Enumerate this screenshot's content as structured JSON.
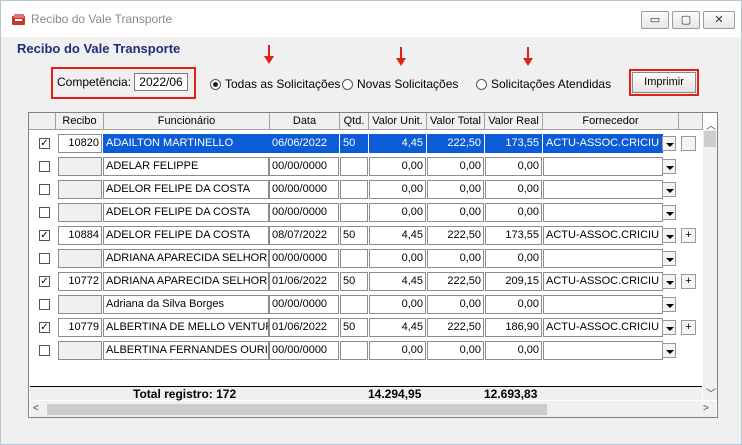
{
  "window": {
    "title": "Recibo do Vale Transporte",
    "buttons": {
      "min": "▭",
      "max": "▢",
      "close": "✕"
    }
  },
  "heading": "Recibo do Vale Transporte",
  "competencia": {
    "label": "Competência:",
    "value": "2022/06"
  },
  "filters": [
    {
      "label": "Todas as Solicitações",
      "selected": true
    },
    {
      "label": "Novas Solicitações",
      "selected": false
    },
    {
      "label": "Solicitações Atendidas",
      "selected": false
    }
  ],
  "print_label": "Imprimir",
  "columns": [
    "Recibo",
    "Funcionário",
    "Data",
    "Qtd.",
    "Valor Unit.",
    "Valor Total",
    "Valor Real",
    "Fornecedor"
  ],
  "rows": [
    {
      "checked": true,
      "recibo": "10820",
      "funcionario": "ADAILTON MARTINELLO",
      "data": "06/06/2022",
      "qtd": "50",
      "unit": "4,45",
      "total": "222,50",
      "real": "173,55",
      "fornecedor": "ACTU-ASSOC.CRICIU",
      "plus": ""
    },
    {
      "checked": false,
      "recibo": "",
      "funcionario": "ADELAR FELIPPE",
      "data": "00/00/0000",
      "qtd": "",
      "unit": "0,00",
      "total": "0,00",
      "real": "0,00",
      "fornecedor": "",
      "plus": ""
    },
    {
      "checked": false,
      "recibo": "",
      "funcionario": "ADELOR FELIPE DA COSTA",
      "data": "00/00/0000",
      "qtd": "",
      "unit": "0,00",
      "total": "0,00",
      "real": "0,00",
      "fornecedor": "",
      "plus": ""
    },
    {
      "checked": false,
      "recibo": "",
      "funcionario": "ADELOR FELIPE DA COSTA",
      "data": "00/00/0000",
      "qtd": "",
      "unit": "0,00",
      "total": "0,00",
      "real": "0,00",
      "fornecedor": "",
      "plus": ""
    },
    {
      "checked": true,
      "recibo": "10884",
      "funcionario": "ADELOR FELIPE DA COSTA",
      "data": "08/07/2022",
      "qtd": "50",
      "unit": "4,45",
      "total": "222,50",
      "real": "173,55",
      "fornecedor": "ACTU-ASSOC.CRICIU",
      "plus": "+"
    },
    {
      "checked": false,
      "recibo": "",
      "funcionario": "ADRIANA APARECIDA SELHORST",
      "data": "00/00/0000",
      "qtd": "",
      "unit": "0,00",
      "total": "0,00",
      "real": "0,00",
      "fornecedor": "",
      "plus": ""
    },
    {
      "checked": true,
      "recibo": "10772",
      "funcionario": "ADRIANA APARECIDA SELHORST",
      "data": "01/06/2022",
      "qtd": "50",
      "unit": "4,45",
      "total": "222,50",
      "real": "209,15",
      "fornecedor": "ACTU-ASSOC.CRICIU",
      "plus": "+"
    },
    {
      "checked": false,
      "recibo": "",
      "funcionario": "Adriana da Silva Borges",
      "data": "00/00/0000",
      "qtd": "",
      "unit": "0,00",
      "total": "0,00",
      "real": "0,00",
      "fornecedor": "",
      "plus": ""
    },
    {
      "checked": true,
      "recibo": "10779",
      "funcionario": "ALBERTINA DE MELLO VENTURA",
      "data": "01/06/2022",
      "qtd": "50",
      "unit": "4,45",
      "total": "222,50",
      "real": "186,90",
      "fornecedor": "ACTU-ASSOC.CRICIU",
      "plus": "+"
    },
    {
      "checked": false,
      "recibo": "",
      "funcionario": "ALBERTINA FERNANDES OURIQUES",
      "data": "00/00/0000",
      "qtd": "",
      "unit": "0,00",
      "total": "0,00",
      "real": "0,00",
      "fornecedor": "",
      "plus": ""
    }
  ],
  "totals": {
    "label": "Total registro: 172",
    "total": "14.294,95",
    "real": "12.693,83"
  },
  "colors": {
    "accent": "#1f2d7a",
    "highlight": "#e0201a",
    "selection": "#0b5cd5"
  }
}
